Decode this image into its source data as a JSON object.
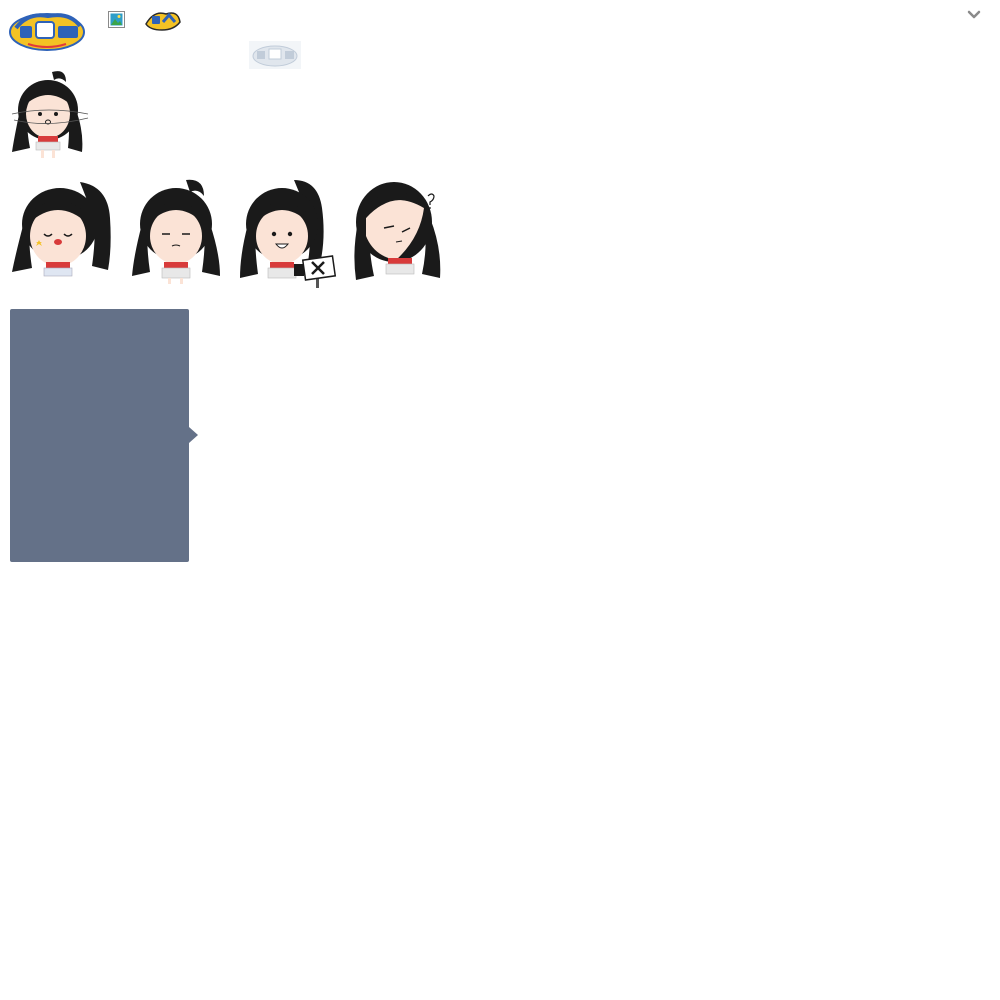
{
  "header": {
    "logo_main_icon": "pansstar-logo",
    "broken_image_icon": "broken-image-icon",
    "logo_small_icon": "pans-logo",
    "watermark_icon": "pansstar-watermark",
    "expand_icon": "chevron-down-icon"
  },
  "stickers": {
    "top": "girl-sticker-dizzy",
    "row": [
      "girl-sticker-kiss",
      "girl-sticker-sleepy",
      "girl-sticker-sign",
      "girl-sticker-confused"
    ]
  },
  "panel": {
    "color": "#647188"
  },
  "colors": {
    "hair": "#1a1a1a",
    "skin": "#fbe3d6",
    "top": "#d83b3b",
    "skirt": "#e8e8e8",
    "logo_yellow": "#f4c224",
    "logo_blue": "#2e62b8"
  }
}
